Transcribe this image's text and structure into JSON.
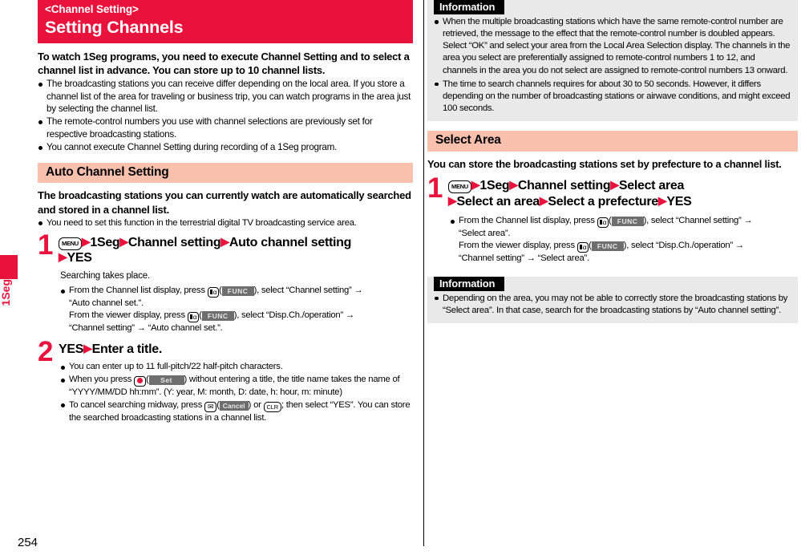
{
  "page": {
    "number": "254",
    "edge_tab_label": "1Seg"
  },
  "title_banner": {
    "subject": "<Channel Setting>",
    "heading": "Setting Channels",
    "bg_color": "#e8123c"
  },
  "left_column": {
    "lead": "To watch 1Seg programs, you need to execute Channel Setting and to select a channel list in advance. You can store up to 10 channel lists.",
    "bullets": [
      "The broadcasting stations you can receive differ depending on the local area. If you store a channel list of the area for traveling or business trip, you can watch programs in the area just by selecting the channel list.",
      "The remote-control numbers you use with channel selections are previously set for respective broadcasting stations.",
      "You cannot execute Channel Setting during recording of a 1Seg program."
    ],
    "section": {
      "header": "Auto Channel Setting",
      "header_bg": "#f9c0ae",
      "lead": "The broadcasting stations you can currently watch are automatically searched and stored in a channel list.",
      "bullets": [
        "You need to set this function in the terrestrial digital TV broadcasting service area."
      ]
    },
    "step1": {
      "number": "1",
      "key_menu": "MENU",
      "part1": "1Seg",
      "part2": "Channel setting",
      "part3": "Auto channel setting",
      "part4": "YES",
      "body_plain": "Searching takes place.",
      "bullet_a_pre": "From the Channel list display, press ",
      "bullet_a_softkey": "FUNC",
      "bullet_a_mid": "), select “Channel setting” →",
      "bullet_a_cont": "“Auto channel set.”.",
      "bullet_b_pre": "From the viewer display, press ",
      "bullet_b_softkey": "FUNC",
      "bullet_b_mid": "), select “Disp.Ch./operation” →",
      "bullet_b_cont": "“Channel setting” → “Auto channel set.”."
    },
    "step2": {
      "number": "2",
      "head_a": "YES",
      "head_b": "Enter a title.",
      "bullet1": "You can enter up to 11 full-pitch/22 half-pitch characters.",
      "bullet2_pre": "When you press ",
      "bullet2_softkey": "Set",
      "bullet2_post": ") without entering a title, the title name takes the name of “YYYY/MM/DD hh:mm”. (Y: year, M: month, D: date, h: hour, m: minute)",
      "bullet3_pre": "To cancel searching midway, press ",
      "bullet3_softkey": "Cancel",
      "bullet3_mid": ") or ",
      "bullet3_clr": "CLR",
      "bullet3_post": "; then select “YES”. You can store the searched broadcasting stations in a channel list."
    }
  },
  "right_column": {
    "info_top": {
      "title": "Information",
      "bullets": [
        "When the multiple broadcasting stations which have the same remote-control number are retrieved, the message to the effect that the remote-control number is doubled appears. Select “OK” and select your area from the Local Area Selection display. The channels in the area you select are preferentially assigned to remote-control numbers 1 to 12, and channels in the area you do not select are assigned to remote-control numbers 13 onward.",
        "The time to search channels requires for about 30 to 50 seconds. However, it differs depending on the number of broadcasting stations or airwave conditions, and might exceed 100 seconds."
      ]
    },
    "section": {
      "header": "Select Area",
      "header_bg": "#f9c0ae",
      "lead": "You can store the broadcasting stations set by prefecture to a channel list."
    },
    "step1": {
      "number": "1",
      "key_menu": "MENU",
      "part1": "1Seg",
      "part2": "Channel setting",
      "part3": "Select area",
      "part4": "Select an area",
      "part5": "Select a prefecture",
      "part6": "YES",
      "bullet_a_pre": "From the Channel list display, press ",
      "bullet_a_softkey": "FUNC",
      "bullet_a_mid": "), select “Channel setting” →",
      "bullet_a_cont": "“Select area”.",
      "bullet_b_pre": "From the viewer display, press ",
      "bullet_b_softkey": "FUNC",
      "bullet_b_mid": "), select “Disp.Ch./operation” →",
      "bullet_b_cont": "“Channel setting” → “Select area”."
    },
    "info_bottom": {
      "title": "Information",
      "bullets": [
        "Depending on the area, you may not be able to correctly store the broadcasting stations by “Select area”. In that case, search for the broadcasting stations by “Auto channel setting”."
      ]
    }
  }
}
